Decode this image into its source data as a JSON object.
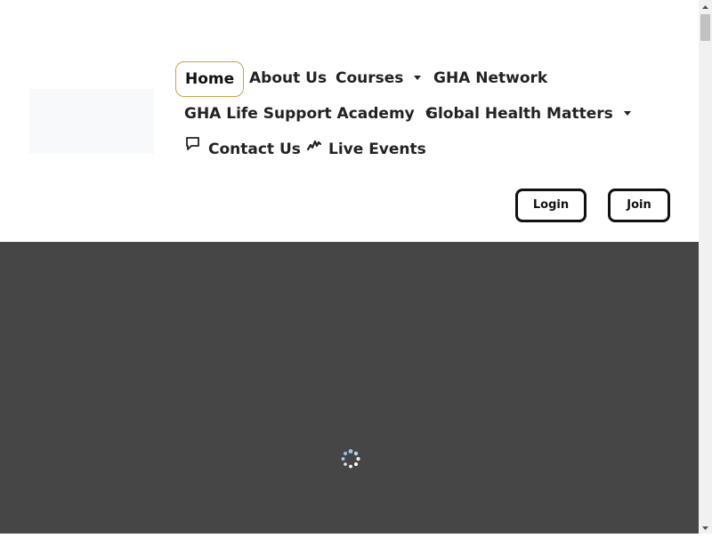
{
  "nav": {
    "home": "Home",
    "about": "About Us",
    "courses": "Courses",
    "network": "GHA Network",
    "academy": "GHA Life Support Academy",
    "global_health": "Global Health Matters",
    "contact": "Contact Us",
    "live_events": "Live Events"
  },
  "auth": {
    "login": "Login",
    "join": "Join"
  },
  "icons": {
    "contact": "chat-bubble-icon",
    "live_events": "pulse-icon",
    "loading": "loading-spinner-icon"
  },
  "colors": {
    "active_border": "#c9a14a",
    "hero_background": "#464646",
    "button_border": "#111111"
  }
}
